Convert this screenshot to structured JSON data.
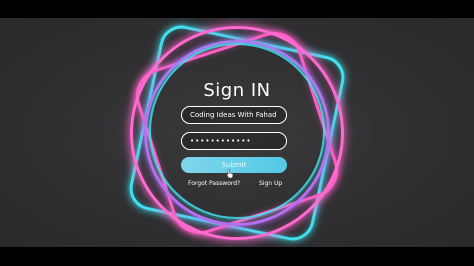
{
  "form": {
    "title": "Sign IN",
    "username_value": "Coding Ideas With Fahad",
    "password_value": "••••••••••••",
    "submit_label": "Submit",
    "forgot_label": "Forgot Password?",
    "signup_label": "Sign Up"
  },
  "colors": {
    "background": "#2f2f31",
    "neon_cyan": "#40e0ee",
    "neon_pink": "#ff5fc4",
    "neon_violet": "#b86df0",
    "button": "#5fcce8"
  }
}
